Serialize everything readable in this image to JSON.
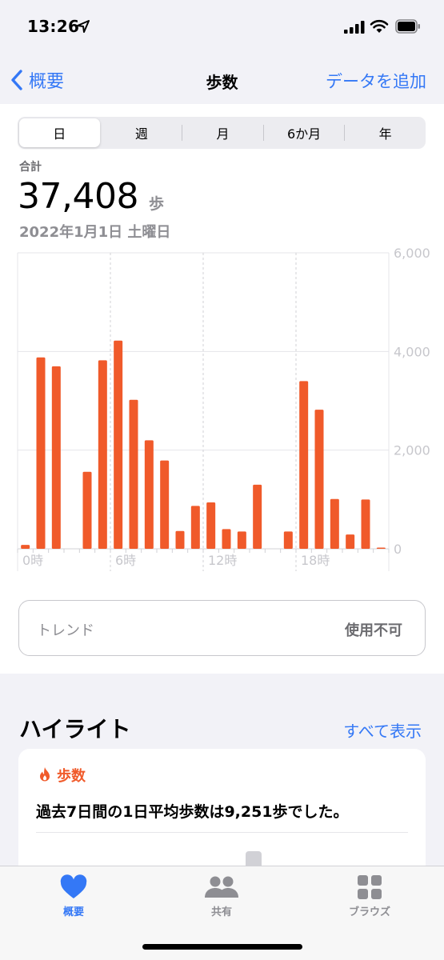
{
  "status_bar": {
    "time": "13:26"
  },
  "nav": {
    "back_label": "概要",
    "title": "歩数",
    "action_label": "データを追加"
  },
  "segments": {
    "day": "日",
    "week": "週",
    "month": "月",
    "six_month": "6か月",
    "year": "年"
  },
  "summary": {
    "label": "合計",
    "value": "37,408",
    "unit": "歩",
    "date": "2022年1月1日 土曜日"
  },
  "chart_data": {
    "type": "bar",
    "categories": [
      "0",
      "1",
      "2",
      "3",
      "4",
      "5",
      "6",
      "7",
      "8",
      "9",
      "10",
      "11",
      "12",
      "13",
      "14",
      "15",
      "16",
      "17",
      "18",
      "19",
      "20",
      "21",
      "22",
      "23"
    ],
    "values": [
      80,
      3880,
      3700,
      0,
      1560,
      3820,
      4220,
      3020,
      2200,
      1790,
      360,
      870,
      940,
      400,
      350,
      1300,
      0,
      350,
      3400,
      2820,
      1010,
      290,
      1000,
      20
    ],
    "x_tick_labels": [
      "0時",
      "6時",
      "12時",
      "18時"
    ],
    "y_tick_labels": [
      "6,000",
      "4,000",
      "2,000",
      "0"
    ],
    "ylim": [
      0,
      6000
    ],
    "bar_color": "#f05a2a",
    "grid": true
  },
  "trend": {
    "label": "トレンド",
    "status": "使用不可"
  },
  "highlights": {
    "title": "ハイライト",
    "show_all": "すべて表示",
    "card": {
      "category": "歩数",
      "text": "過去7日間の1日平均歩数は9,251歩でした。"
    }
  },
  "tabs": [
    {
      "label": "概要",
      "icon": "heart-icon",
      "active": true
    },
    {
      "label": "共有",
      "icon": "people-icon",
      "active": false
    },
    {
      "label": "ブラウズ",
      "icon": "grid-icon",
      "active": false
    }
  ],
  "colors": {
    "accent": "#3478f6",
    "bar": "#f05a2a",
    "highlight": "#f05a2a"
  }
}
